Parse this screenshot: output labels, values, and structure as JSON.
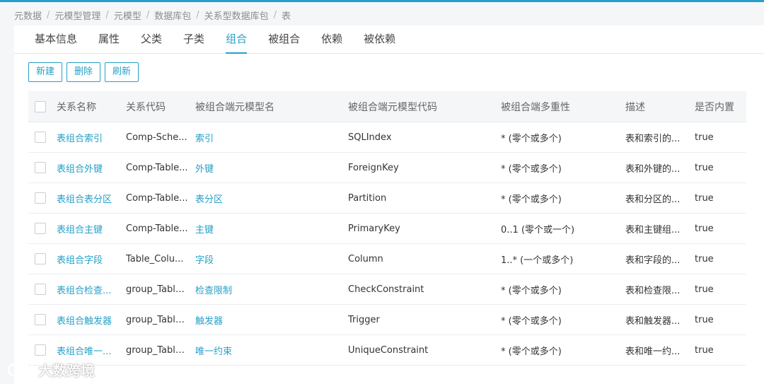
{
  "breadcrumb": [
    "元数据",
    "元模型管理",
    "元模型",
    "数据库包",
    "关系型数据库包",
    "表"
  ],
  "tabs": [
    "基本信息",
    "属性",
    "父类",
    "子类",
    "组合",
    "被组合",
    "依赖",
    "被依赖"
  ],
  "active_tab": "组合",
  "toolbar": {
    "new": "新建",
    "delete": "删除",
    "refresh": "刷新"
  },
  "table": {
    "headers": [
      "关系名称",
      "关系代码",
      "被组合端元模型名",
      "被组合端元模型代码",
      "被组合端多重性",
      "描述",
      "是否内置"
    ],
    "rows": [
      [
        "表组合索引",
        "Comp-Sche...",
        "索引",
        "SQLIndex",
        "* (零个或多个)",
        "表和索引的...",
        "true"
      ],
      [
        "表组合外键",
        "Comp-Table...",
        "外键",
        "ForeignKey",
        "* (零个或多个)",
        "表和外键的...",
        "true"
      ],
      [
        "表组合表分区",
        "Comp-Table...",
        "表分区",
        "Partition",
        "* (零个或多个)",
        "表和分区的...",
        "true"
      ],
      [
        "表组合主键",
        "Comp-Table...",
        "主键",
        "PrimaryKey",
        "0..1 (零个或一个)",
        "表和主键组...",
        "true"
      ],
      [
        "表组合字段",
        "Table_Colu...",
        "字段",
        "Column",
        "1..* (一个或多个)",
        "表和字段的...",
        "true"
      ],
      [
        "表组合检查...",
        "group_Table...",
        "检查限制",
        "CheckConstraint",
        "* (零个或多个)",
        "表和检查限...",
        "true"
      ],
      [
        "表组合触发器",
        "group_Table...",
        "触发器",
        "Trigger",
        "* (零个或多个)",
        "表和触发器...",
        "true"
      ],
      [
        "表组合唯一...",
        "group_Table...",
        "唯一约束",
        "UniqueConstraint",
        "* (零个或多个)",
        "表和唯一约...",
        "true"
      ]
    ]
  },
  "watermark": "大数跨境",
  "colors": {
    "accent": "#26a0c8",
    "header_bg": "#f4f6f8",
    "page_bg": "#f5f6f8"
  }
}
